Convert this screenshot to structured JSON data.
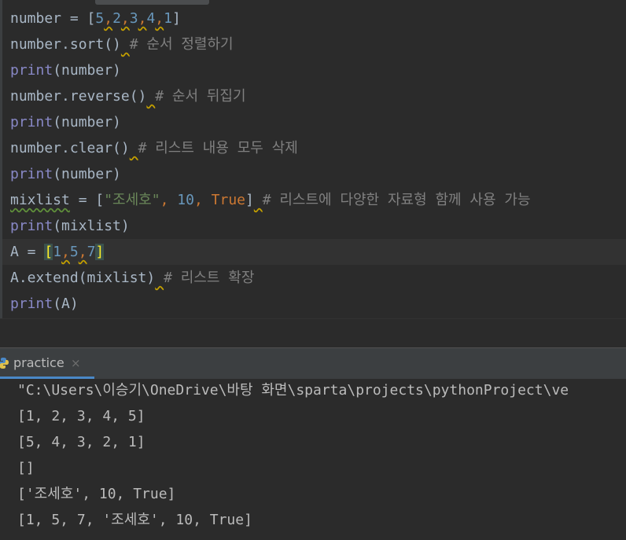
{
  "editor": {
    "lines": [
      {
        "a": "number = [",
        "n1": "5",
        "c1": ",",
        "n2": "2",
        "c2": ",",
        "n3": "3",
        "c3": ",",
        "n4": "4",
        "c4": ",",
        "n5": "1",
        "b": "]"
      },
      {
        "a": "number.sort()",
        "sp": " ",
        "cm": "# 순서 정렬하기"
      },
      {
        "a": "print",
        "b": "(number)"
      },
      {
        "a": "number.reverse()",
        "sp": " ",
        "cm": "# 순서 뒤집기"
      },
      {
        "a": "print",
        "b": "(number)"
      },
      {
        "a": "number.clear()",
        "sp": " ",
        "cm": "# 리스트 내용 모두 삭제"
      },
      {
        "a": "print",
        "b": "(number)"
      },
      {
        "a": "mixlist",
        "b": " = [",
        "s": "\"조세호\"",
        "c1": ", ",
        "n": "10",
        "c2": ", ",
        "t": "True",
        "e": "]",
        "sp": " ",
        "cm": "# 리스트에 다양한 자료형 함께 사용 가능"
      },
      {
        "a": "print",
        "b": "(mixlist)"
      },
      {
        "a": "A = ",
        "lb": "[",
        "n1": "1",
        "c1": ",",
        "n2": "5",
        "c2": ",",
        "n3": "7",
        "rb": "]"
      },
      {
        "a": "A.extend(mixlist)",
        "sp": " ",
        "cm": "# 리스트 확장"
      },
      {
        "a": "print",
        "b": "(A)"
      }
    ]
  },
  "run": {
    "tab_label": "practice",
    "close": "×",
    "output": [
      "\"C:\\Users\\이승기\\OneDrive\\바탕 화면\\sparta\\projects\\pythonProject\\ve",
      "[1, 2, 3, 4, 5]",
      "[5, 4, 3, 2, 1]",
      "[]",
      "['조세호', 10, True]",
      "[1, 5, 7, '조세호', 10, True]"
    ]
  }
}
